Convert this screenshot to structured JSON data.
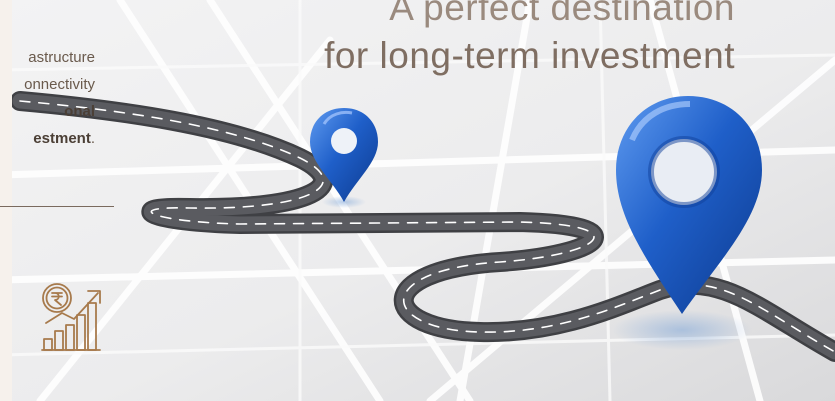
{
  "hero": {
    "headline_line1": "A perfect destination",
    "headline_line2": "for long-term investment"
  },
  "side_text": {
    "line1": "astructure",
    "line2": "onnectivity",
    "line3_bold": "onal",
    "line4_bold": "estment",
    "line4_suffix": "."
  },
  "icons": {
    "growth": "rupee-growth-chart-icon",
    "location_pin": "map-pin-icon"
  },
  "colors": {
    "accent_brown": "#a77a4c",
    "pin_blue": "#1f5fc9",
    "road_gray": "#4a4b4f",
    "panel_bg": "#f6f1ec"
  }
}
